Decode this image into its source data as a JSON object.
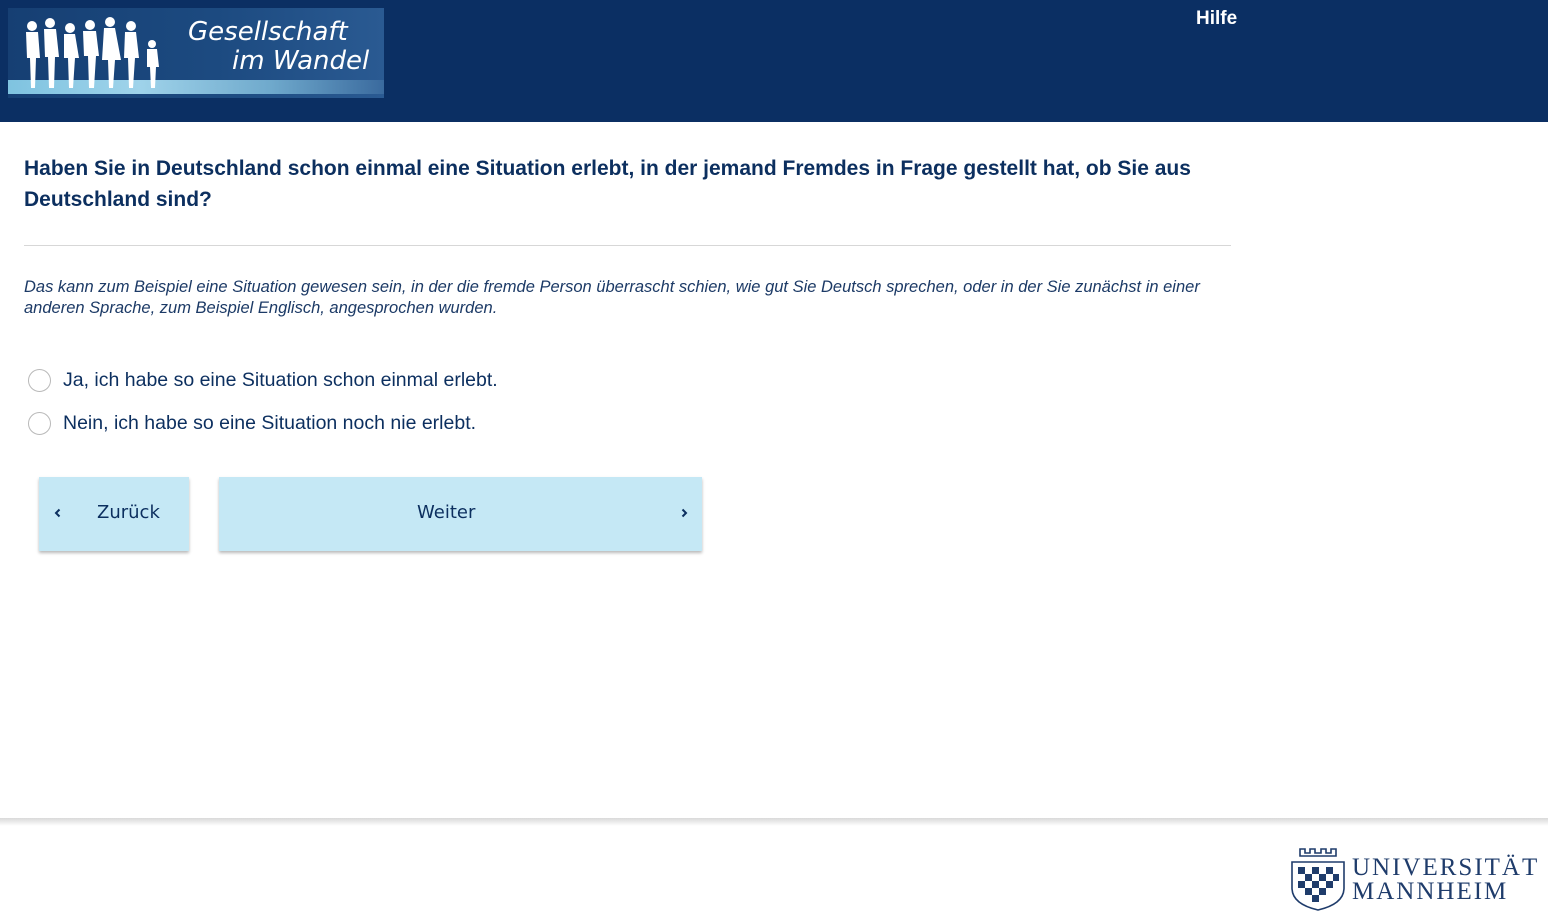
{
  "header": {
    "logo": {
      "line1": "Gesellschaft",
      "line2": "im Wandel"
    },
    "help_label": "Hilfe",
    "background_color": "#0b2f63"
  },
  "question": {
    "title": "Haben Sie in Deutschland schon einmal eine Situation erlebt, in der jemand Fremdes in Frage gestellt hat, ob Sie aus Deutschland sind?",
    "hint": "Das kann zum Beispiel eine Situation gewesen sein, in der die fremde Person überrascht schien, wie gut Sie Deutsch sprechen, oder in der Sie zunächst in einer anderen Sprache, zum Beispiel Englisch, angesprochen wurden."
  },
  "options": [
    {
      "label": "Ja, ich habe so eine Situation schon einmal erlebt.",
      "selected": false
    },
    {
      "label": "Nein, ich habe so eine Situation noch nie erlebt.",
      "selected": false
    }
  ],
  "navigation": {
    "back_label": "Zurück",
    "next_label": "Weiter",
    "button_color": "#c5e8f5"
  },
  "footer": {
    "university_line1": "UNIVERSITÄT",
    "university_line2": "MANNHEIM"
  }
}
